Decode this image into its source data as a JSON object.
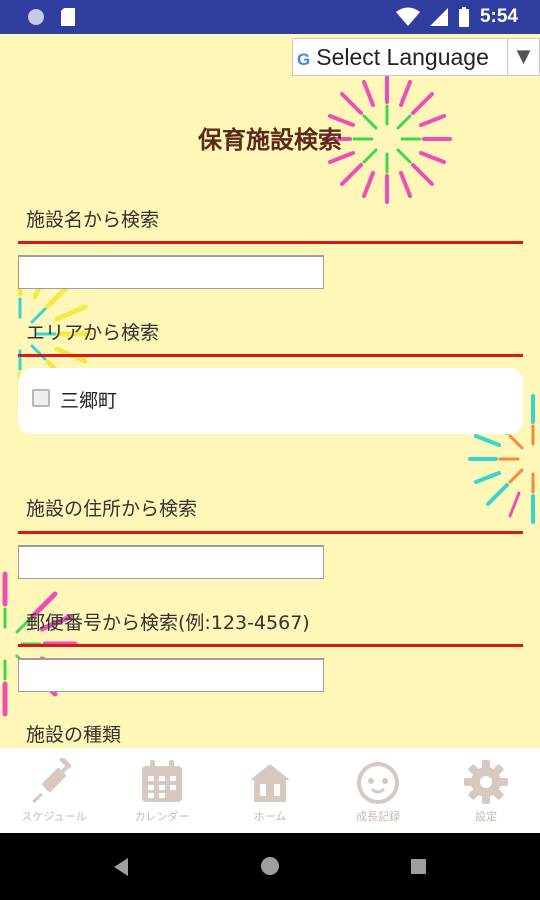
{
  "statusbar": {
    "time": "5:54"
  },
  "language": {
    "label": "Select Language",
    "google_mark": "G"
  },
  "page_title": "保育施設検索",
  "sections": {
    "name_search": {
      "label": "施設名から検索",
      "value": ""
    },
    "area_search": {
      "label": "エリアから検索",
      "options": [
        {
          "label": "三郷町",
          "checked": false
        }
      ]
    },
    "address_search": {
      "label": "施設の住所から検索",
      "value": ""
    },
    "postal_search": {
      "label": "郵便番号から検索(例:123-4567)",
      "value": ""
    },
    "type_search": {
      "label": "施設の種類"
    }
  },
  "nav": [
    {
      "label": "スケジュール",
      "icon": "syringe-icon"
    },
    {
      "label": "カレンダー",
      "icon": "calendar-icon"
    },
    {
      "label": "ホーム",
      "icon": "home-icon"
    },
    {
      "label": "成長記録",
      "icon": "baby-face-icon"
    },
    {
      "label": "設定",
      "icon": "gear-icon"
    }
  ],
  "colors": {
    "background": "#fff7b8",
    "title": "#5a2b1a",
    "accent_rule": "#d6191a",
    "nav_icon": "#d7c8c0",
    "statusbar": "#303f9f"
  }
}
